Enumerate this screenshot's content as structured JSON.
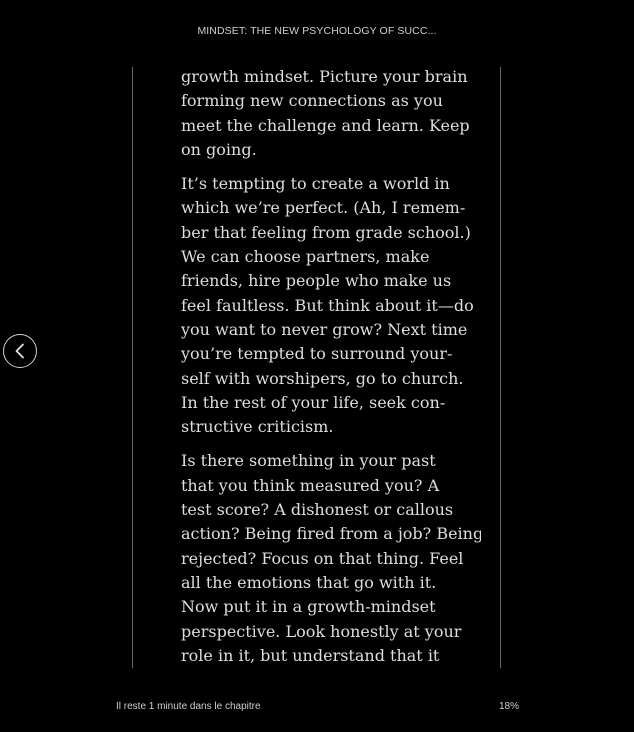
{
  "header": {
    "book_title": "MINDSET: THE NEW PSYCHOLOGY OF SUCC..."
  },
  "navigation": {
    "previous_page_icon": "chevron-left-icon"
  },
  "reader": {
    "paragraph_continuation": [
      "growth mindset. Picture your brain",
      "forming new connections as you",
      "meet the challenge and learn. Keep",
      "on going."
    ],
    "bullet_1": [
      "It’s tempting to create a world in",
      "which we’re perfect. (Ah, I remem-",
      "ber that feeling from grade school.)",
      "We can choose partners, make",
      "friends, hire people who make us",
      "feel faultless. But think about it—do",
      "you want to never grow? Next time",
      "you’re tempted to surround your-",
      "self with worshipers, go to church.",
      "In the rest of your life, seek con-",
      "structive criticism."
    ],
    "bullet_2": [
      "Is there something in your past",
      "that you think measured you? A",
      "test score? A dishonest or callous",
      "action? Being fired from a job? Being",
      "rejected? Focus on that thing. Feel",
      "all the emotions that go with it.",
      "Now put it in a growth-mindset",
      "perspective. Look honestly at your",
      "role in it, but understand that it"
    ],
    "bullet_char": "•"
  },
  "footer": {
    "time_remaining": "Il reste 1 minute dans le chapitre",
    "progress_percent": "18%"
  }
}
